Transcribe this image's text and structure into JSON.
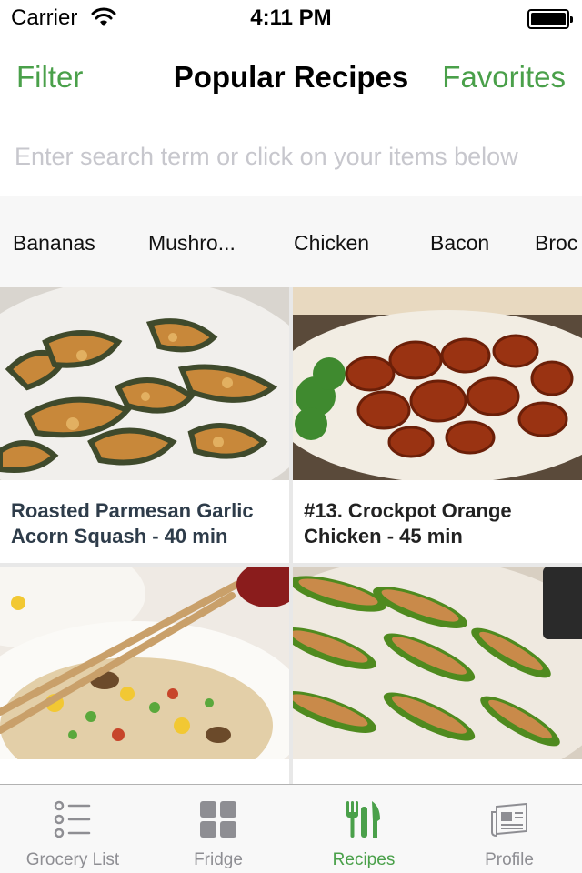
{
  "status_bar": {
    "carrier": "Carrier",
    "time": "4:11 PM",
    "battery_level": 1.0
  },
  "nav": {
    "left": "Filter",
    "title": "Popular Recipes",
    "right": "Favorites"
  },
  "search": {
    "value": "",
    "placeholder": "Enter search term or click on your items below"
  },
  "chips": [
    "Bananas",
    "Mushro...",
    "Chicken",
    "Bacon",
    "Broc"
  ],
  "recipes": [
    {
      "title": "Roasted Parmesan Garlic Acorn Squash - 40 min",
      "image": "acorn-squash-photo"
    },
    {
      "title": "#13. Crockpot Orange Chicken - 45 min",
      "image": "orange-chicken-photo"
    },
    {
      "title": "",
      "image": "fried-rice-photo"
    },
    {
      "title": "",
      "image": "stuffed-jalapenos-photo"
    }
  ],
  "tabs": [
    {
      "label": "Grocery List",
      "icon": "list-icon",
      "active": false
    },
    {
      "label": "Fridge",
      "icon": "grid-icon",
      "active": false
    },
    {
      "label": "Recipes",
      "icon": "cutlery-icon",
      "active": true
    },
    {
      "label": "Profile",
      "icon": "newspaper-icon",
      "active": false
    }
  ],
  "colors": {
    "accent": "#4aa04a",
    "inactive": "#8e8e93",
    "chips_background": "#f7f7f7",
    "placeholder": "#c7c7cd"
  }
}
